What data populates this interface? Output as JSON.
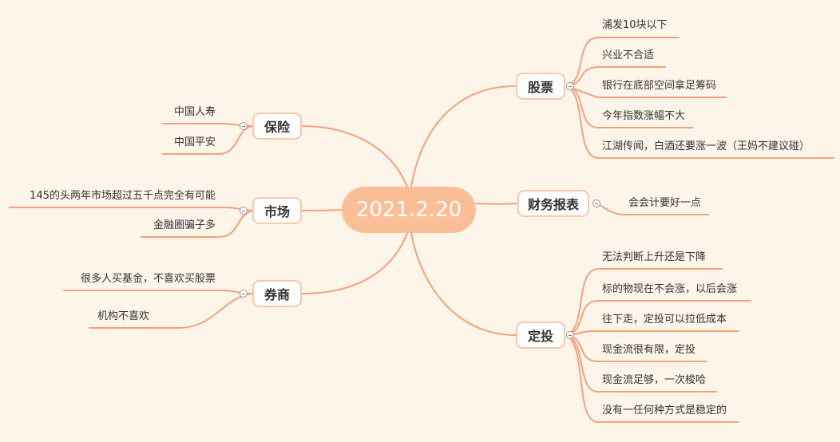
{
  "center": {
    "label": "2021.2.20"
  },
  "colors": {
    "line": "#f9a07a",
    "center": "#fbbe96",
    "topic_border": "#f9c9a7",
    "background": "#fdf5ea"
  },
  "topics": {
    "gupiao": {
      "label": "股票",
      "items": [
        "浦发10块以下",
        "兴业不合适",
        "银行在底部空间拿足筹码",
        "今年指数涨幅不大",
        "江湖传闻，白酒还要涨一波（王妈不建议碰）"
      ]
    },
    "caiwu": {
      "label": "财务报表",
      "items": [
        "会会计要好一点"
      ]
    },
    "dingtou": {
      "label": "定投",
      "items": [
        "无法判断上升还是下降",
        "标的物现在不会涨，以后会涨",
        "往下走，定投可以拉低成本",
        "现金流很有限，定投",
        "现金流足够，一次梭哈",
        "没有一任何种方式是稳定的"
      ]
    },
    "baoxian": {
      "label": "保险",
      "items": [
        "中国人寿",
        "中国平安"
      ]
    },
    "shichang": {
      "label": "市场",
      "items": [
        "145的头两年市场超过五千点完全有可能",
        "金融圈骗子多"
      ]
    },
    "quanshang": {
      "label": "券商",
      "items": [
        "很多人买基金，不喜欢买股票",
        "机构不喜欢"
      ]
    }
  }
}
